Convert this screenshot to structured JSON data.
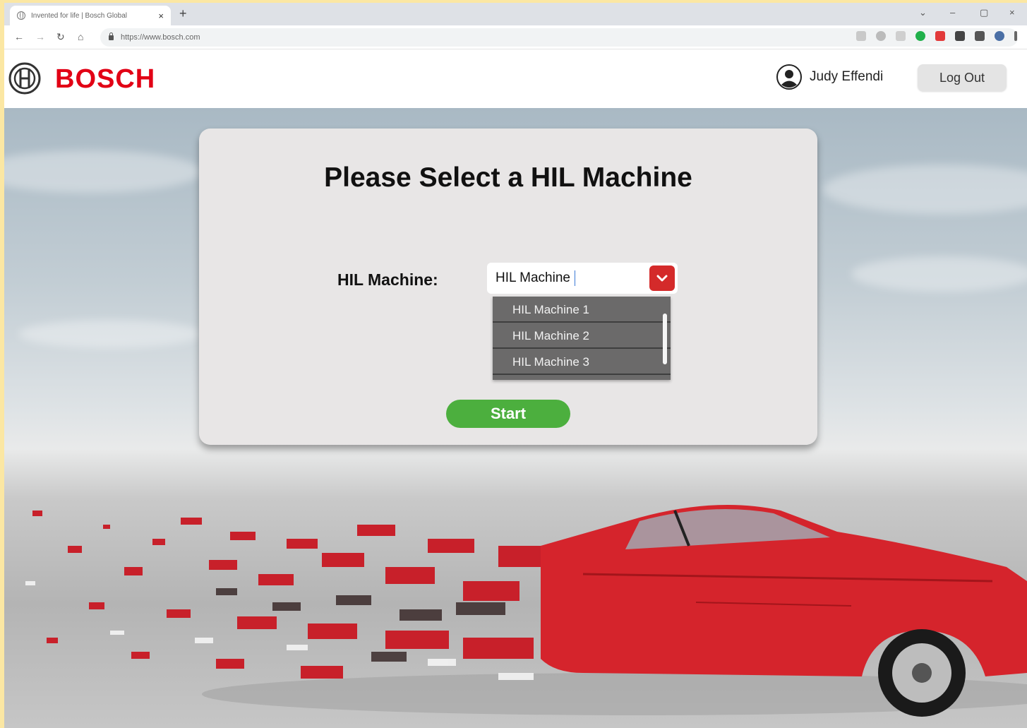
{
  "browser": {
    "tab_title": "Invented for life | Bosch Global",
    "tab_close": "×",
    "new_tab": "+",
    "url": "https://www.bosch.com",
    "window_controls": [
      "⌄",
      "–",
      "▢",
      "×"
    ],
    "nav": {
      "back": "←",
      "forward": "→",
      "reload": "↻",
      "home": "⌂"
    }
  },
  "header": {
    "brand": "BOSCH",
    "brand_color": "#e20015",
    "user_name": "Judy Effendi",
    "logout_label": "Log Out"
  },
  "card": {
    "title": "Please Select a HIL Machine",
    "field_label": "HIL Machine:",
    "select_value": "HIL Machine",
    "options": [
      "HIL Machine 1",
      "HIL Machine 2",
      "HIL Machine 3"
    ],
    "start_label": "Start"
  },
  "colors": {
    "start_button": "#4caf3e",
    "dropdown_toggle": "#d42a2a",
    "dropdown_list": "#6b6a6a"
  }
}
